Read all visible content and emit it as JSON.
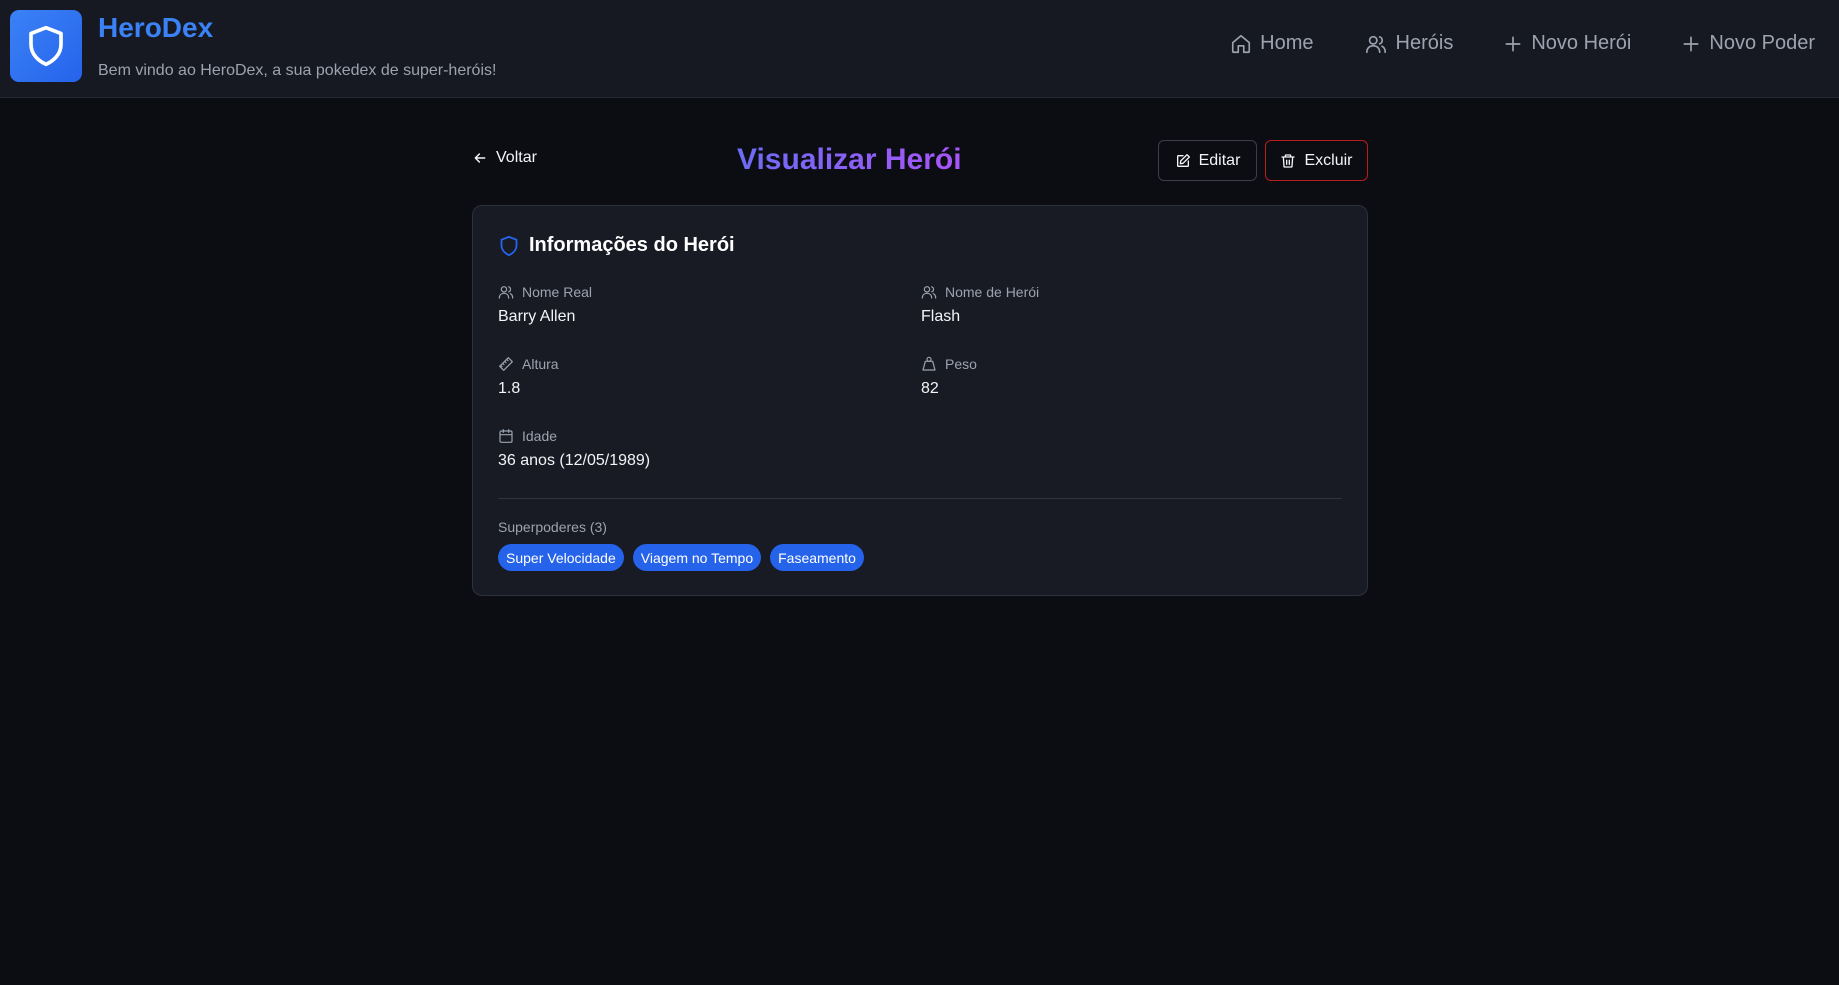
{
  "header": {
    "brand_title": "HeroDex",
    "brand_subtitle": "Bem vindo ao HeroDex, a sua pokedex de super-heróis!",
    "nav": [
      {
        "label": "Home",
        "icon": "home-icon"
      },
      {
        "label": "Heróis",
        "icon": "users-icon"
      },
      {
        "label": "Novo Herói",
        "icon": "plus-icon"
      },
      {
        "label": "Novo Poder",
        "icon": "plus-icon"
      }
    ]
  },
  "page": {
    "back_label": "Voltar",
    "title": "Visualizar Herói",
    "edit_label": "Editar",
    "delete_label": "Excluir"
  },
  "card": {
    "title": "Informações do Herói",
    "fields": {
      "real_name": {
        "label": "Nome Real",
        "value": "Barry Allen",
        "icon": "users-icon"
      },
      "hero_name": {
        "label": "Nome de Herói",
        "value": "Flash",
        "icon": "users-icon"
      },
      "height": {
        "label": "Altura",
        "value": "1.8",
        "icon": "ruler-icon"
      },
      "weight": {
        "label": "Peso",
        "value": "82",
        "icon": "weight-icon"
      },
      "age": {
        "label": "Idade",
        "value": "36 anos (12/05/1989)",
        "icon": "calendar-icon"
      }
    },
    "powers_label": "Superpoderes (3)",
    "powers": [
      "Super Velocidade",
      "Viagem no Tempo",
      "Faseamento"
    ]
  },
  "colors": {
    "accent": "#3b82f6",
    "badge": "#2563eb",
    "danger": "#b91c1c",
    "title_gradient_start": "#6d6cf4",
    "title_gradient_end": "#a855f7"
  }
}
